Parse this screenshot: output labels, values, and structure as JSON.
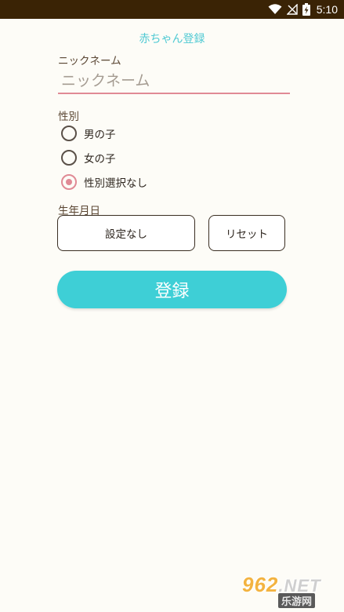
{
  "status_bar": {
    "time": "5:10",
    "icons": [
      "wifi-icon",
      "signal-off-icon",
      "battery-charging-icon"
    ]
  },
  "title": "赤ちゃん登録",
  "nickname": {
    "label": "ニックネーム",
    "placeholder": "ニックネーム",
    "value": ""
  },
  "gender": {
    "label": "性別",
    "options": [
      {
        "label": "男の子",
        "checked": false
      },
      {
        "label": "女の子",
        "checked": false
      },
      {
        "label": "性別選択なし",
        "checked": true
      }
    ]
  },
  "birthday": {
    "label": "生年月日",
    "date_button": "設定なし",
    "reset_button": "リセット"
  },
  "register_button": "登録",
  "watermark": {
    "main": "962",
    "suffix": ".NET",
    "sub": "乐游网"
  },
  "colors": {
    "accent": "#3ecfd6",
    "title": "#4ec9d3",
    "radio_selected": "#e08a95",
    "status_bar": "#3a2305",
    "background": "#fdfcf7"
  }
}
